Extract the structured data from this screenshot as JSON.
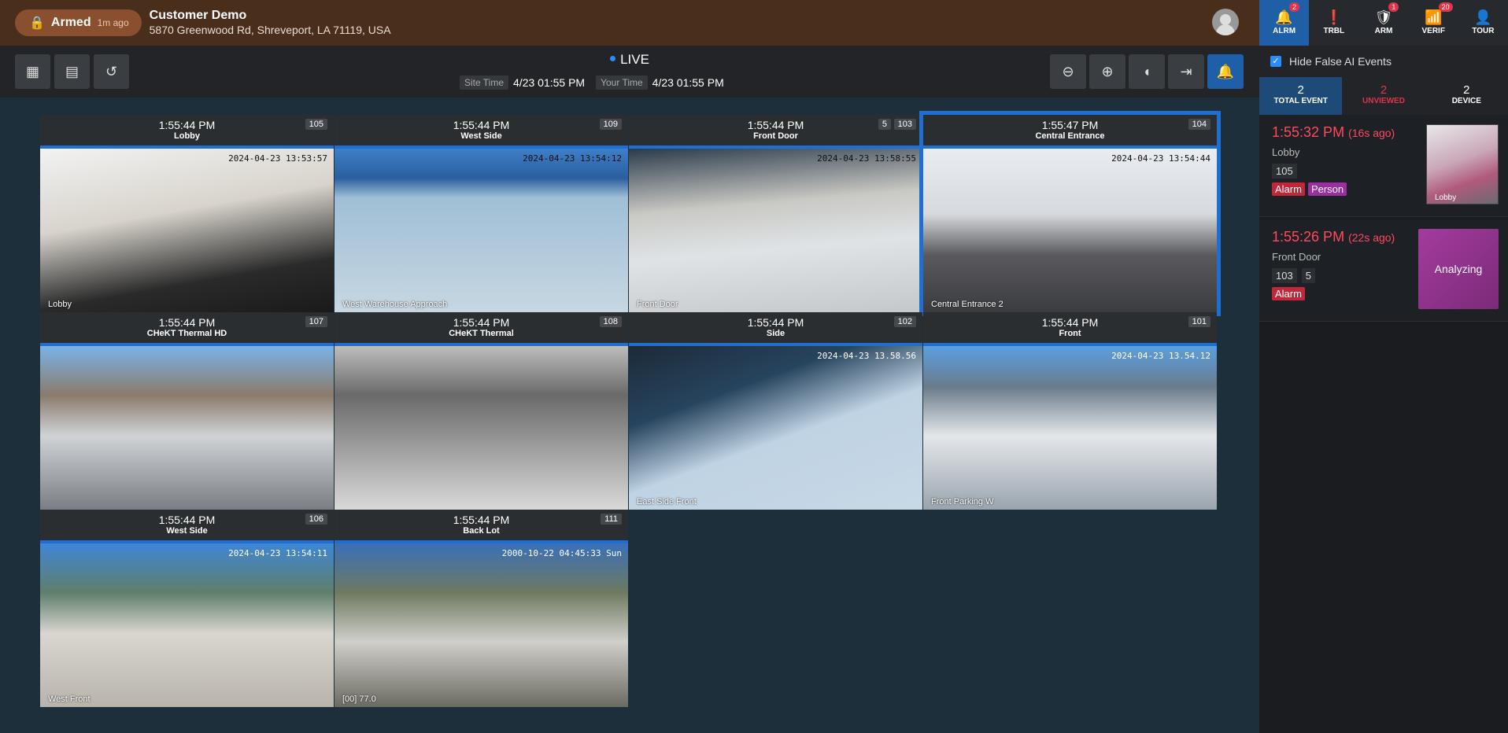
{
  "header": {
    "armed_label": "Armed",
    "armed_ago": "1m ago",
    "site_name": "Customer Demo",
    "site_address": "5870 Greenwood Rd, Shreveport, LA 71119, USA"
  },
  "toolbar": {
    "live_label": "LIVE",
    "site_time_label": "Site Time",
    "site_time": "4/23 01:55 PM",
    "your_time_label": "Your Time",
    "your_time": "4/23 01:55 PM"
  },
  "cameras": [
    {
      "time": "1:55:44 PM",
      "name": "Lobby",
      "num": "105",
      "num2": "",
      "stamp": "2024-04-23 13:53:57",
      "caption": "Lobby"
    },
    {
      "time": "1:55:44 PM",
      "name": "West Side",
      "num": "109",
      "num2": "",
      "stamp": "2024-04-23 13:54:12",
      "caption": "West Warehouse Approach"
    },
    {
      "time": "1:55:44 PM",
      "name": "Front Door",
      "num": "103",
      "num2": "5",
      "stamp": "2024-04-23 13:58:55",
      "caption": "Front Door"
    },
    {
      "time": "1:55:47 PM",
      "name": "Central Entrance",
      "num": "104",
      "num2": "",
      "stamp": "2024-04-23 13:54:44",
      "caption": "Central Entrance 2"
    },
    {
      "time": "1:55:44 PM",
      "name": "CHeKT Thermal HD",
      "num": "107",
      "num2": "",
      "stamp": "",
      "caption": ""
    },
    {
      "time": "1:55:44 PM",
      "name": "CHeKT Thermal",
      "num": "108",
      "num2": "",
      "stamp": "",
      "caption": ""
    },
    {
      "time": "1:55:44 PM",
      "name": "Side",
      "num": "102",
      "num2": "",
      "stamp": "2024-04-23 13.58.56",
      "caption": "East Side Front"
    },
    {
      "time": "1:55:44 PM",
      "name": "Front",
      "num": "101",
      "num2": "",
      "stamp": "2024-04-23 13.54.12",
      "caption": "Front Parking W"
    },
    {
      "time": "1:55:44 PM",
      "name": "West Side",
      "num": "106",
      "num2": "",
      "stamp": "2024-04-23 13:54:11",
      "caption": "West Front"
    },
    {
      "time": "1:55:44 PM",
      "name": "Back Lot",
      "num": "111",
      "num2": "",
      "stamp": "2000-10-22 04:45:33 Sun",
      "caption": "[00] 77.0"
    }
  ],
  "right_panel": {
    "tabs": [
      {
        "label": "ALRM",
        "badge": "2",
        "icon": "bell-icon"
      },
      {
        "label": "TRBL",
        "badge": "",
        "icon": "alert-circle-icon"
      },
      {
        "label": "ARM",
        "badge": "1",
        "icon": "shield-check-icon"
      },
      {
        "label": "VERIF",
        "badge": "20",
        "icon": "remote-icon"
      },
      {
        "label": "TOUR",
        "badge": "",
        "icon": "user-icon"
      }
    ],
    "hide_false_label": "Hide False AI Events",
    "stats": [
      {
        "n": "2",
        "l": "TOTAL EVENT"
      },
      {
        "n": "2",
        "l": "UNVIEWED"
      },
      {
        "n": "2",
        "l": "DEVICE"
      }
    ],
    "events": [
      {
        "time": "1:55:32 PM",
        "ago": "(16s ago)",
        "name": "Lobby",
        "num": "105",
        "num2": "",
        "tag1": "Alarm",
        "tag2": "Person",
        "thumb_caption": "Lobby"
      },
      {
        "time": "1:55:26 PM",
        "ago": "(22s ago)",
        "name": "Front Door",
        "num": "103",
        "num2": "5",
        "tag1": "Alarm",
        "tag2": "",
        "analyzing": "Analyzing"
      }
    ]
  },
  "colors": {
    "accent": "#1e6fd1",
    "alarm": "#e0344a",
    "header": "#4a2e1c"
  }
}
